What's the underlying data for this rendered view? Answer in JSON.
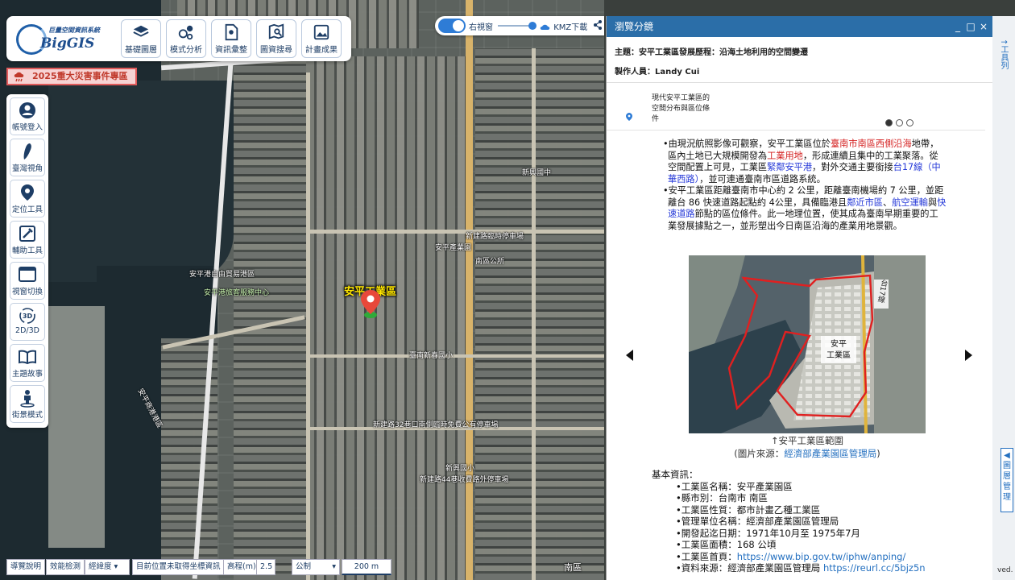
{
  "logo": {
    "subtitle": "巨量空間資訊系統",
    "brand": "BigGIS"
  },
  "toolbar": {
    "items": [
      {
        "label": "基礎圖層",
        "icon": "layers-icon"
      },
      {
        "label": "模式分析",
        "icon": "analysis-icon"
      },
      {
        "label": "資訊彙整",
        "icon": "document-map-icon"
      },
      {
        "label": "圖資搜尋",
        "icon": "search-map-icon"
      },
      {
        "label": "計畫成果",
        "icon": "image-gallery-icon"
      }
    ]
  },
  "disaster_banner": {
    "label": "2025重大災害事件專區",
    "icon": "cloud-rain-icon"
  },
  "sidebar": {
    "items": [
      {
        "label": "帳號登入",
        "icon": "user-icon"
      },
      {
        "label": "臺灣視角",
        "icon": "taiwan-icon"
      },
      {
        "label": "定位工具",
        "icon": "location-pin-icon"
      },
      {
        "label": "輔助工具",
        "icon": "tools-icon"
      },
      {
        "label": "視窗切換",
        "icon": "window-icon"
      },
      {
        "label": "2D/3D",
        "icon": "3d-icon"
      },
      {
        "label": "主題故事",
        "icon": "book-icon"
      },
      {
        "label": "街景模式",
        "icon": "pegman-icon"
      }
    ]
  },
  "map_controls": {
    "right_window": "右視窗",
    "kmz": "KMZ下載"
  },
  "map_labels": {
    "main": "安平工業區",
    "labels": [
      "安平港自由貿易港區",
      "安平港旅客服務中心",
      "新興國中",
      "新建路臨時停車場",
      "安平產業園",
      "南區公所",
      "臺南新春國小",
      "新建路32巷口南側臨時免費公有停車場",
      "新建路44巷收費路外停車場",
      "新興國小",
      "安平商港港區",
      "南區"
    ]
  },
  "panel": {
    "title": "瀏覽分鏡",
    "window_controls": [
      "_",
      "□",
      "×"
    ],
    "topic_label": "主題：",
    "topic": "安平工業區發展歷程：沿海土地利用的空間變遷",
    "author_label": "製作人員：",
    "author": "Landy Cui",
    "slide_title": "現代安平工業區的空間分布與區位條件",
    "paragraph1": [
      {
        "t": "•由現況航照影像可觀察，安平工業區位於",
        "c": ""
      },
      {
        "t": "臺南市南區西側沿海",
        "c": "red"
      },
      {
        "t": "地帶，區內土地已大規模開發為",
        "c": ""
      },
      {
        "t": "工業用地",
        "c": "red"
      },
      {
        "t": "，形成連續且集中的工業聚落。從空間配置上可見，工業區",
        "c": ""
      },
      {
        "t": "緊鄰安平港",
        "c": "blue"
      },
      {
        "t": "，對外交通主要銜接",
        "c": ""
      },
      {
        "t": "台17線（中華西路）",
        "c": "blue"
      },
      {
        "t": "，並可連通臺南市區道路系統。",
        "c": ""
      }
    ],
    "paragraph2": [
      {
        "t": "•安平工業區距離臺南市中心約 2 公里，距離臺南機場約 7 公里，並距離台 86 快速道路起點約 4公里，具備臨港且",
        "c": ""
      },
      {
        "t": "鄰近市區",
        "c": "blue"
      },
      {
        "t": "、",
        "c": ""
      },
      {
        "t": "航空運輸",
        "c": "blue"
      },
      {
        "t": "與",
        "c": ""
      },
      {
        "t": "快速道路",
        "c": "blue"
      },
      {
        "t": "節點的區位條件。此一地理位置，使其成為臺南早期重要的工業發展據點之一，並形塑出今日南區沿海的產業用地景觀。",
        "c": ""
      }
    ],
    "figure": {
      "road_label": "台17線",
      "area_label_1": "安平",
      "area_label_2": "工業區"
    },
    "figure_caption": "↑安平工業區範圍",
    "figure_source_prefix": "(圖片來源：",
    "figure_source_link": "經濟部產業園區管理局",
    "figure_source_suffix": ")",
    "info_heading": "基本資訊：",
    "info": [
      {
        "label": "•工業區名稱：",
        "value": "安平產業園區"
      },
      {
        "label": "•縣市別：",
        "value": "台南市 南區"
      },
      {
        "label": "•工業區性質：",
        "value": "都市計畫乙種工業區"
      },
      {
        "label": "•管理單位名稱：",
        "value": "經濟部產業園區管理局"
      },
      {
        "label": "•開發起迄日期：",
        "value": "1971年10月至 1975年7月"
      },
      {
        "label": "•工業區面積：",
        "value": "168 公頃"
      },
      {
        "label": "•工業區首頁：",
        "value": "https://www.bip.gov.tw/iphw/anping/",
        "link": true
      },
      {
        "label": "•資料來源：經濟部產業園區管理局 ",
        "value": "https://reurl.cc/5bjz5n",
        "link": true
      }
    ]
  },
  "edge": {
    "side_label": "↑工具列",
    "layer_tab": "◀ 圖層管理",
    "footer": "ved."
  },
  "bottom_bar": {
    "guide": "導覽說明",
    "perf": "效能檢測",
    "coord_select": "經緯度",
    "coord_status": "目前位置未取得坐標資訊",
    "elevation_label": "高程(m)",
    "elevation_value": "2.5",
    "unit_select": "公制",
    "scale": "200 m"
  }
}
